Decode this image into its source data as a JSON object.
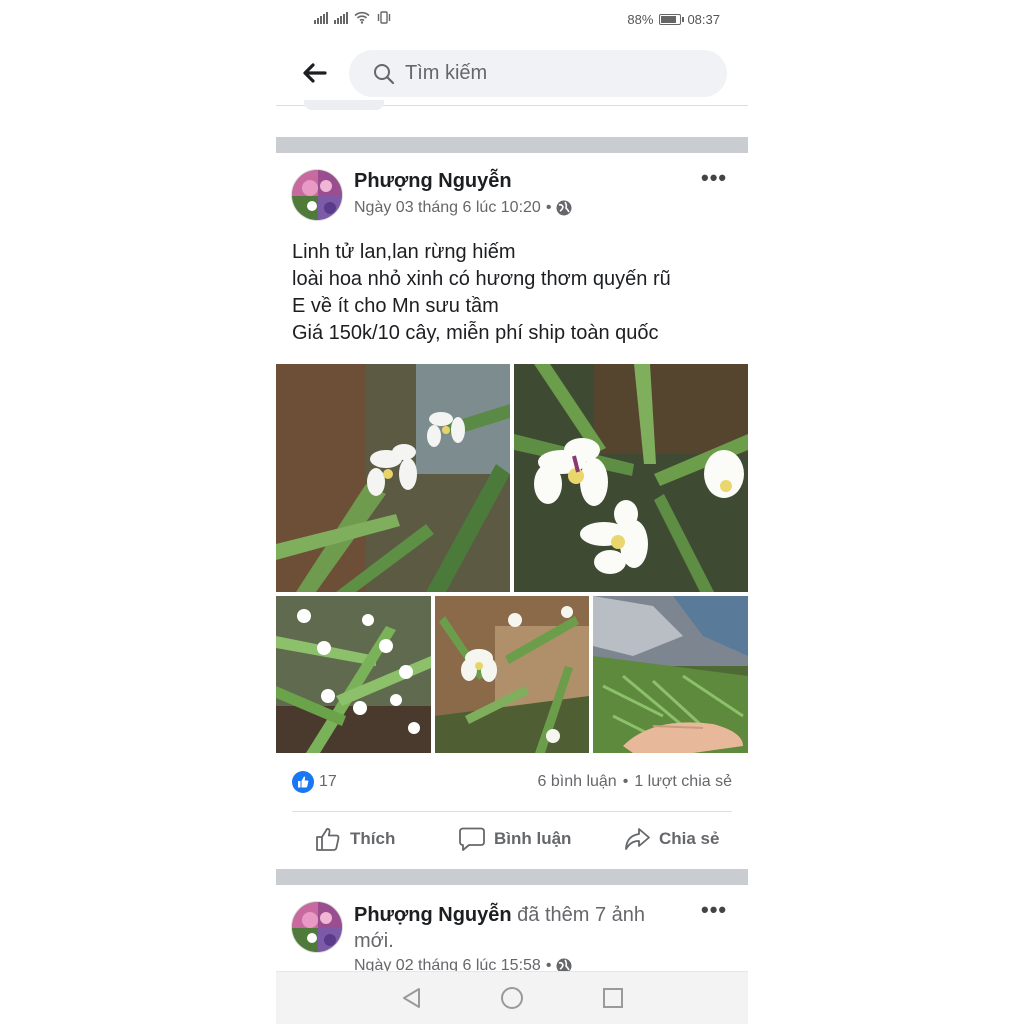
{
  "status_bar": {
    "battery_percent": "88%",
    "battery_level": 0.88,
    "time": "08:37"
  },
  "search": {
    "placeholder": "Tìm kiếm"
  },
  "post": {
    "author": "Phượng Nguyễn",
    "timestamp": "Ngày 03 tháng 6 lúc 10:20",
    "separator_dot": "•",
    "privacy_icon": "globe-icon",
    "text_lines": [
      "Linh tử lan,lan rừng hiếm",
      "loài hoa nhỏ xinh có hương thơm quyến rũ",
      "E về ít cho Mn sưu tầm",
      "Giá 150k/10 cây, miễn phí ship toàn quốc"
    ],
    "like_count": "17",
    "comments": "6 bình luận",
    "shares": "1 lượt chia sẻ",
    "stats_dot": "•",
    "actions": {
      "like": "Thích",
      "comment": "Bình luận",
      "share": "Chia sẻ"
    }
  },
  "post2": {
    "author": "Phượng Nguyễn",
    "action_text": " đã thêm 7 ảnh mới.",
    "timestamp": "Ngày 02 tháng 6 lúc 15:58",
    "separator_dot": "•"
  },
  "colors": {
    "facebook_blue": "#1877f2",
    "secondary_text": "#65676b",
    "separator": "#c9ccd1"
  }
}
